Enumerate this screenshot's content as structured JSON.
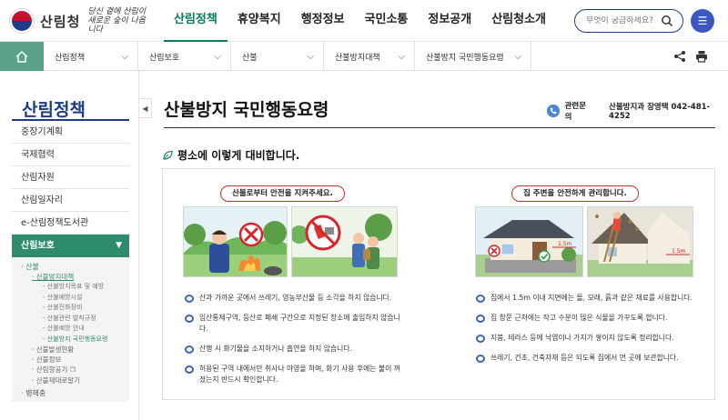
{
  "header": {
    "logo_text": "산림청",
    "logo_slogan": "당신 곁에 산림이 새로운 숲이 나옵니다",
    "gnb": [
      "산림정책",
      "휴양복지",
      "행정정보",
      "국민소통",
      "정보공개",
      "산림청소개"
    ],
    "gnb_active_index": 0,
    "search_placeholder": "무엇이 궁금하세요?"
  },
  "breadcrumb": [
    "산림정책",
    "산림보호",
    "산불",
    "산불방지대책",
    "산불방지 국민행동요령"
  ],
  "sidebar": {
    "title": "산림정책",
    "items": [
      "중장기계획",
      "국제협력",
      "산림자원",
      "산림일자리",
      "e-산림정책도서관"
    ],
    "active_group": "산림보호",
    "sub_level1": [
      "산불"
    ],
    "sub_level2_current": "산불방지대책",
    "sub_level3": [
      "산불방지목표 및 예방",
      "산불예방시설",
      "산불진화장비",
      "산불관련 벌칙규정",
      "산불예방 안내",
      "산불방지 국민행동요령"
    ],
    "sub_level2_more": [
      "산불발생현황",
      "산불정보",
      "산림항공기",
      "산불제대로알기"
    ],
    "sub_level1_more": [
      "병해충"
    ]
  },
  "main": {
    "title": "산불방지 국민행동요령",
    "inquiry_label": "관련문의",
    "inquiry_value": "산불방지과 장영택 042-481-4252",
    "section_title": "평소에 이렇게 대비합니다.",
    "left_box": {
      "heading": "산불로부터 안전을 지켜주세요.",
      "bullets": [
        "산과 가까운 곳에서 쓰레기, 영농부산물 등 소각을 하지 않습니다.",
        "입산통제구역, 등산로 폐쇄 구간으로 지정된 장소에 출입하지 않습니다.",
        "산행 시 화기물을 소지하거나 흡연을 하지 않습니다.",
        "허용된 구역 내에서만 취사나 야영을 하며, 화기 사용 후에는 불이 꺼졌는지 반드시 확인합니다."
      ]
    },
    "right_box": {
      "heading": "집 주변을 안전하게 관리합니다.",
      "bullets": [
        "집에서 1.5m 이내 지면에는 돌, 모래, 흙과 같은 재료를 사용합니다.",
        "집 창문 근처에는 작고 수분이 많은 식물을 가꾸도록 합니다.",
        "지붕, 테라스 등에 낙엽이나 가지가 쌓이지 않도록 정리합니다.",
        "쓰레기, 건초, 건축자재 등은 되도록 집에서 먼 곳에 보관합니다."
      ],
      "distance_label": "1.5m"
    }
  }
}
